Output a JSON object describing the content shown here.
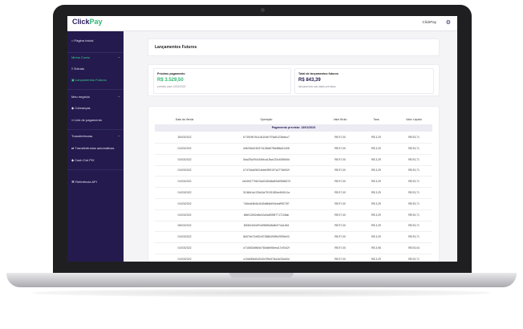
{
  "topbar": {
    "logo_main": "Click",
    "logo_accent": "Pay",
    "user": "ClickPay",
    "gear_icon": "gear-icon"
  },
  "sidebar": {
    "items": [
      {
        "icon": "home-icon",
        "label": "Página Inicial"
      },
      {
        "label": "Minha Conta",
        "section": true
      },
      {
        "icon": "list-icon",
        "label": "Extrato"
      },
      {
        "icon": "calendar-icon",
        "label": "Lançamentos Futuros",
        "active": true
      },
      {
        "label": "Meu negócio",
        "section": true
      },
      {
        "icon": "tag-icon",
        "label": "Cobranças"
      },
      {
        "icon": "link-icon",
        "label": "Link de pagamento"
      },
      {
        "label": "Transferências",
        "section": true
      },
      {
        "icon": "transfer-icon",
        "label": "Transferências automáticas"
      },
      {
        "icon": "diamond-icon",
        "label": "Cash Out PIX"
      },
      {
        "icon": "code-icon",
        "label": "Referência API"
      }
    ]
  },
  "page": {
    "title": "Lançamentos Futuros"
  },
  "summary": {
    "next_label": "Próximo pagamento",
    "next_value": "R$ 3.529,50",
    "next_sub": "previsto para 13/01/2023",
    "total_label": "Total de lançamentos futuros",
    "total_value": "R$ 843,39",
    "total_sub": "lançamentos nas datas previstas"
  },
  "table": {
    "headers": [
      "Data da Venda",
      "Operação",
      "Valor Bruto",
      "Taxa",
      "Valor Líquido"
    ],
    "group": "Pagamento previsto: 13/01/2023",
    "rows": [
      [
        "30/03/2022",
        "b73919b76c1d410db7f76a5123fabcc7",
        "R$ 97,00",
        "R$ 3,29",
        "R$ 93,71"
      ],
      [
        "01/03/2022",
        "e5b29e6245374128d6f7f8e8f6d61408",
        "R$ 97,00",
        "R$ 3,29",
        "R$ 93,71"
      ],
      [
        "01/03/2022",
        "5da2f3c094c34fdca13ba133c4065b5d",
        "R$ 97,00",
        "R$ 3,29",
        "R$ 93,71"
      ],
      [
        "01/03/2022",
        "b747b4a05624ebe09f9197a2776bf02f",
        "R$ 97,00",
        "R$ 3,29",
        "R$ 93,71"
      ],
      [
        "01/03/2022",
        "2a01507796224a9180d6d69a59686373",
        "R$ 97,00",
        "R$ 3,29",
        "R$ 93,71"
      ],
      [
        "01/03/2022",
        "3136fd1a133b43a79191185ee84f141a",
        "R$ 97,00",
        "R$ 3,29",
        "R$ 93,71"
      ],
      [
        "01/03/2022",
        "746bdb3b5d1645d6b8d94ebcff9573f7",
        "R$ 97,00",
        "R$ 3,29",
        "R$ 93,71"
      ],
      [
        "01/03/2022",
        "68ef12b52a5e42a0a8095f7717126ab",
        "R$ 97,00",
        "R$ 3,29",
        "R$ 93,71"
      ],
      [
        "06/03/2022",
        "83060450df7b4f5f8f5d5d8e974a1484",
        "R$ 97,00",
        "R$ 3,29",
        "R$ 93,71"
      ],
      [
        "01/03/2022",
        "8b576e72ef524f72886495f9d7895e03",
        "R$ 97,00",
        "R$ 3,29",
        "R$ 93,71"
      ],
      [
        "01/03/2022",
        "d7165f2a96f4e784b8e98eea17c9342f",
        "R$ 97,00",
        "R$ 3,96",
        "R$ 93,04"
      ],
      [
        "01/03/2022",
        "c19d0f0b654942e7f5b57fa16e33dd0d",
        "R$ 97,00",
        "R$ 3,29",
        "R$ 93,71"
      ]
    ]
  }
}
